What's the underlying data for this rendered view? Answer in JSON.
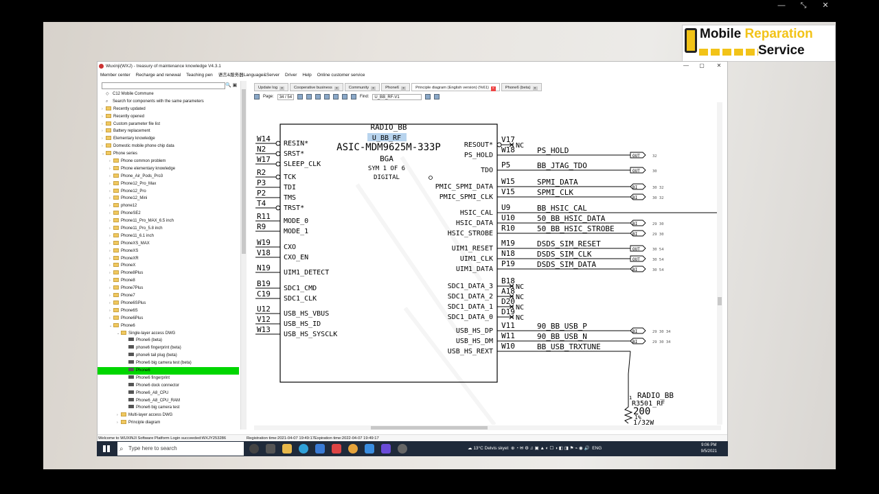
{
  "outer_controls": {
    "min": "—",
    "restore": "⤡",
    "close": "✕"
  },
  "brand": {
    "word1": "Mobile",
    "word2": "Reparation",
    "word3": "Service"
  },
  "window": {
    "title": "Wuxinji(WXJ) - treasury of maintenance knowledge V4.3.1",
    "min": "—",
    "max": "▢",
    "close": "✕"
  },
  "menu": [
    "Member center",
    "Recharge and renewal",
    "Teaching pen",
    "语言&服务器Language&Server",
    "Driver",
    "Help",
    "Online customer service"
  ],
  "tree": [
    {
      "label": "C12 Mobile Commune",
      "kind": "icon",
      "lvl": 0
    },
    {
      "label": "Search for components with the same parameters",
      "kind": "icon",
      "lvl": 0
    },
    {
      "label": "Recently updated",
      "kind": "folder",
      "lvl": 0
    },
    {
      "label": "Recently opened",
      "kind": "folder",
      "lvl": 0
    },
    {
      "label": "Custom parameter file list",
      "kind": "folder",
      "lvl": 0
    },
    {
      "label": "Battery replacement",
      "kind": "folder",
      "lvl": 0
    },
    {
      "label": "Elementary knowledge",
      "kind": "folder",
      "lvl": 0
    },
    {
      "label": "Domestic mobile phone chip data",
      "kind": "folder",
      "lvl": 0
    },
    {
      "label": "Phone series",
      "kind": "folder",
      "lvl": 0,
      "open": true
    },
    {
      "label": "Phone common problem",
      "kind": "folder",
      "lvl": 1
    },
    {
      "label": "Phone elementary knowledge",
      "kind": "folder",
      "lvl": 1
    },
    {
      "label": "Phone_Air_Pods_Pro3",
      "kind": "folder",
      "lvl": 1
    },
    {
      "label": "Phone12_Pro_Max",
      "kind": "folder",
      "lvl": 1
    },
    {
      "label": "Phone12_Pro",
      "kind": "folder",
      "lvl": 1
    },
    {
      "label": "Phone12_Mini",
      "kind": "folder",
      "lvl": 1
    },
    {
      "label": "phone12",
      "kind": "folder",
      "lvl": 1
    },
    {
      "label": "PhoneSE2",
      "kind": "folder",
      "lvl": 1
    },
    {
      "label": "Phone11_Pro_MAX_6.5 inch",
      "kind": "folder",
      "lvl": 1
    },
    {
      "label": "Phone11_Pro_5.8 inch",
      "kind": "folder",
      "lvl": 1
    },
    {
      "label": "Phone11_6.1 inch",
      "kind": "folder",
      "lvl": 1
    },
    {
      "label": "PhoneXS_MAX",
      "kind": "folder",
      "lvl": 1
    },
    {
      "label": "PhoneXS",
      "kind": "folder",
      "lvl": 1
    },
    {
      "label": "PhoneXR",
      "kind": "folder",
      "lvl": 1
    },
    {
      "label": "PhoneX",
      "kind": "folder",
      "lvl": 1
    },
    {
      "label": "Phone8Plus",
      "kind": "folder",
      "lvl": 1
    },
    {
      "label": "Phone8",
      "kind": "folder",
      "lvl": 1
    },
    {
      "label": "Phone7Plus",
      "kind": "folder",
      "lvl": 1
    },
    {
      "label": "Phone7",
      "kind": "folder",
      "lvl": 1
    },
    {
      "label": "Phone6SPlus",
      "kind": "folder",
      "lvl": 1
    },
    {
      "label": "Phone6S",
      "kind": "folder",
      "lvl": 1
    },
    {
      "label": "Phone6Plus",
      "kind": "folder",
      "lvl": 1
    },
    {
      "label": "Phone6",
      "kind": "folder",
      "lvl": 1,
      "open": true
    },
    {
      "label": "Single-layer access DWG",
      "kind": "folder",
      "lvl": 2,
      "open": true
    },
    {
      "label": "Phone6 (beta)",
      "kind": "doc",
      "lvl": 3
    },
    {
      "label": "phone6 fingerprint (beta)",
      "kind": "doc",
      "lvl": 3
    },
    {
      "label": "phone6 tail plug (beta)",
      "kind": "doc",
      "lvl": 3
    },
    {
      "label": "Phone6 big camera test (beta)",
      "kind": "doc",
      "lvl": 3
    },
    {
      "label": "Phone6",
      "kind": "doc",
      "lvl": 3,
      "sel": true
    },
    {
      "label": "Phone6 fingerprint",
      "kind": "doc",
      "lvl": 3
    },
    {
      "label": "Phone6 dock connector",
      "kind": "doc",
      "lvl": 3
    },
    {
      "label": "Phone6_A8_CPU",
      "kind": "doc",
      "lvl": 3
    },
    {
      "label": "Phone6_A8_CPU_RAM",
      "kind": "doc",
      "lvl": 3
    },
    {
      "label": "Phone6 big camera test",
      "kind": "doc",
      "lvl": 3
    },
    {
      "label": "Multi-layer access DWG",
      "kind": "folder",
      "lvl": 2
    },
    {
      "label": "Principle diagram",
      "kind": "folder",
      "lvl": 2
    }
  ],
  "tabs": [
    {
      "label": "Update log",
      "active": false
    },
    {
      "label": "Cooperative business",
      "active": false
    },
    {
      "label": "Community",
      "active": false
    },
    {
      "label": "Phone6",
      "active": false
    },
    {
      "label": "Principle diagram (English version) (%61)",
      "active": true
    },
    {
      "label": "Phone6 (beta)",
      "active": false
    }
  ],
  "toolbar": {
    "page_label": "Page:",
    "page_value": "34 / 54",
    "find_label": "Find:",
    "find_value": "U_BB_RF-V1"
  },
  "schematic": {
    "part": "RADIO_BB",
    "refdes": "U_BB_RF",
    "chip": "ASIC-MDM9625M-333P",
    "pkg": "BGA",
    "sym": "SYM 1 OF 6",
    "func": "DIGITAL",
    "left_pins": [
      {
        "ball": "W14",
        "name": "RESIN*"
      },
      {
        "ball": "N2",
        "name": "SRST*"
      },
      {
        "ball": "W17",
        "name": "SLEEP_CLK"
      },
      {
        "ball": "R2",
        "name": "TCK"
      },
      {
        "ball": "P3",
        "name": "TDI"
      },
      {
        "ball": "P2",
        "name": "TMS"
      },
      {
        "ball": "T4",
        "name": "TRST*"
      },
      {
        "ball": "R11",
        "name": "MODE_0"
      },
      {
        "ball": "R9",
        "name": "MODE_1"
      },
      {
        "ball": "W19",
        "name": "CXO"
      },
      {
        "ball": "V18",
        "name": "CXO_EN"
      },
      {
        "ball": "N19",
        "name": "UIM1_DETECT"
      },
      {
        "ball": "B19",
        "name": "SDC1_CMD"
      },
      {
        "ball": "C19",
        "name": "SDC1_CLK"
      },
      {
        "ball": "U12",
        "name": "USB_HS_VBUS"
      },
      {
        "ball": "V12",
        "name": "USB_HS_ID"
      },
      {
        "ball": "W13",
        "name": "USB_HS_SYSCLK"
      }
    ],
    "right_pins": [
      {
        "ball": "V17",
        "name": "RESOUT*",
        "net": "NC"
      },
      {
        "ball": "W18",
        "name": "PS_HOLD",
        "net": "PS_HOLD",
        "port": "OUT",
        "page": "32"
      },
      {
        "ball": "P5",
        "name": "TDO",
        "net": "BB_JTAG_TDO",
        "port": "OUT",
        "page": "30"
      },
      {
        "ball": "W15",
        "name": "PMIC_SPMI_DATA",
        "net": "SPMI_DATA",
        "port": "BI",
        "page": "30 32"
      },
      {
        "ball": "V15",
        "name": "PMIC_SPMI_CLK",
        "net": "SPMI_CLK",
        "port": "BI",
        "page": "30 32"
      },
      {
        "ball": "U9",
        "name": "HSIC_CAL",
        "net": "BB_HSIC_CAL"
      },
      {
        "ball": "U10",
        "name": "HSIC_DATA",
        "net": "50_BB_HSIC_DATA",
        "port": "BI",
        "page": "29 30"
      },
      {
        "ball": "R10",
        "name": "HSIC_STROBE",
        "net": "50_BB_HSIC_STROBE",
        "port": "BI",
        "page": "29 30"
      },
      {
        "ball": "M19",
        "name": "UIM1_RESET",
        "net": "DSDS_SIM_RESET",
        "port": "OUT",
        "page": "30 54"
      },
      {
        "ball": "N18",
        "name": "UIM1_CLK",
        "net": "DSDS_SIM_CLK",
        "port": "OUT",
        "page": "30 54"
      },
      {
        "ball": "P19",
        "name": "UIM1_DATA",
        "net": "DSDS_SIM_DATA",
        "port": "BI",
        "page": "30 54"
      },
      {
        "ball": "B18",
        "name": "SDC1_DATA_3",
        "net": "NC"
      },
      {
        "ball": "A18",
        "name": "SDC1_DATA_2",
        "net": "NC"
      },
      {
        "ball": "D20",
        "name": "SDC1_DATA_1",
        "net": "NC"
      },
      {
        "ball": "D19",
        "name": "SDC1_DATA_0",
        "net": "NC"
      },
      {
        "ball": "V11",
        "name": "USB_HS_DP",
        "net": "90_BB_USB_P",
        "port": "BI",
        "page": "29 30 34"
      },
      {
        "ball": "W11",
        "name": "USB_HS_DM",
        "net": "90_BB_USB_N",
        "port": "BI",
        "page": "29 30 34"
      },
      {
        "ball": "W10",
        "name": "USB_HS_REXT",
        "net": "BB_USB_TRXTUNE"
      }
    ],
    "resistor": {
      "part": "RADIO_BB",
      "ref": "R3501_RF",
      "value": "200",
      "tol": "1%",
      "power": "1/32W",
      "pin": "1"
    }
  },
  "status": {
    "left": "Welcome to WUXINJI Software Platform  Login succeeded:WXJY253286",
    "right": "Registration time:2021-04-07 19:49:17Expiration time:2022-04-07 19:49:17"
  },
  "taskbar": {
    "search": "Type here to search",
    "weather": "13°C  Delvis skyet",
    "lang": "ENG",
    "time": "9:06 PM",
    "date": "9/5/2021"
  }
}
